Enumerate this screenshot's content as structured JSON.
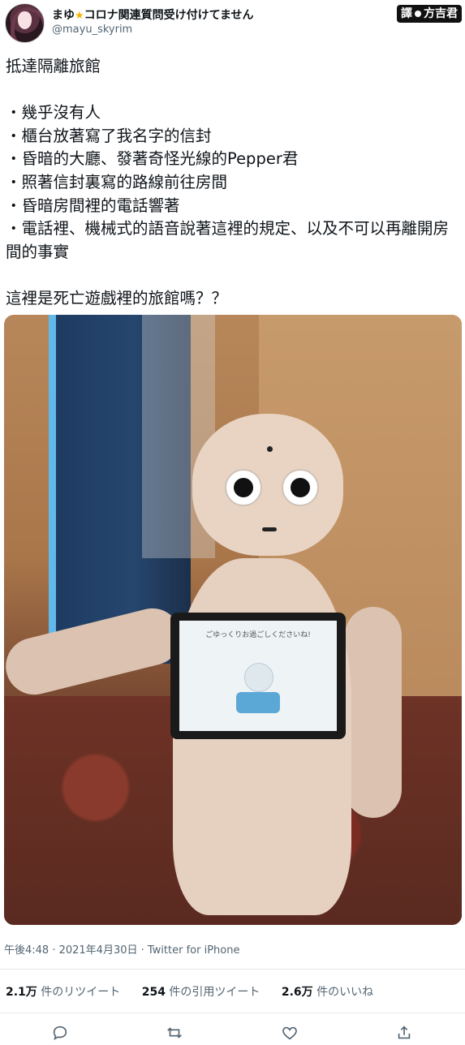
{
  "tweet": {
    "display_name": "まゆ",
    "display_name_suffix": "コロナ関連質問受け付けてません",
    "handle": "@mayu_skyrim",
    "translator_tag_left": "譯",
    "translator_tag_right": "方吉君",
    "text": "抵達隔離旅館\n\n・幾乎沒有人\n・櫃台放著寫了我名字的信封\n・昏暗的大廳、發著奇怪光線的Pepper君\n・照著信封裏寫的路線前往房間\n・昏暗房間裡的電話響著\n・電話裡、機械式的語音說著這裡的規定、以及不可以再離開房間的事實\n\n這裡是死亡遊戲裡的旅館嗎？？",
    "image": {
      "tablet_screen_text": "ごゆっくりお過ごしくださいね!"
    },
    "meta": "午後4:48 · 2021年4月30日 · Twitter for iPhone"
  },
  "stats": [
    {
      "count": "2.1万",
      "label": "件のリツイート"
    },
    {
      "count": "254",
      "label": "件の引用ツイート"
    },
    {
      "count": "2.6万",
      "label": "件のいいね"
    }
  ],
  "actions": [
    "reply-icon",
    "retweet-icon",
    "like-icon",
    "share-icon"
  ]
}
